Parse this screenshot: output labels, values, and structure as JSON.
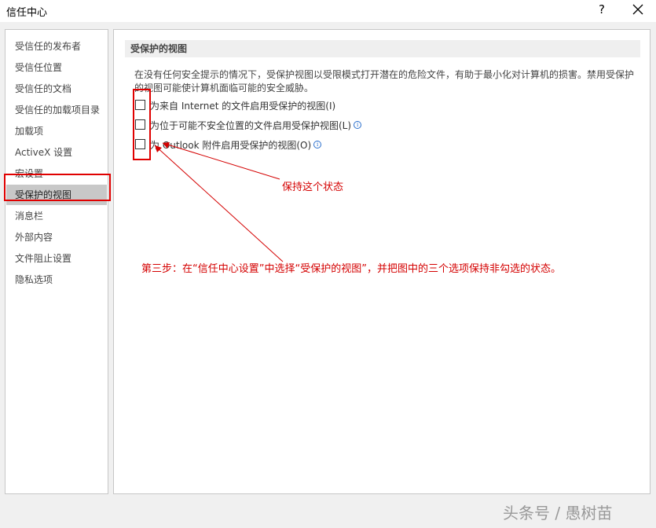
{
  "window": {
    "title": "信任中心",
    "help_label": "?",
    "close_icon": "close-icon"
  },
  "sidebar": {
    "items": [
      {
        "label": "受信任的发布者"
      },
      {
        "label": "受信任位置"
      },
      {
        "label": "受信任的文档"
      },
      {
        "label": "受信任的加载项目录"
      },
      {
        "label": "加载项"
      },
      {
        "label": "ActiveX 设置"
      },
      {
        "label": "宏设置"
      },
      {
        "label": "受保护的视图",
        "selected": true
      },
      {
        "label": "消息栏"
      },
      {
        "label": "外部内容"
      },
      {
        "label": "文件阻止设置"
      },
      {
        "label": "隐私选项"
      }
    ]
  },
  "main": {
    "section_title": "受保护的视图",
    "description": "在没有任何安全提示的情况下，受保护视图以受限模式打开潜在的危险文件，有助于最小化对计算机的损害。禁用受保护的视图可能使计算机面临可能的安全威胁。",
    "options": [
      {
        "label": "为来自 Internet 的文件启用受保护的视图(I)",
        "checked": false,
        "info_icon": false
      },
      {
        "label": "为位于可能不安全位置的文件启用受保护视图(L)",
        "checked": false,
        "info_icon": true
      },
      {
        "label": "为 Outlook 附件启用受保护的视图(O)",
        "checked": false,
        "info_icon": true
      }
    ]
  },
  "annotations": {
    "keep_state": "保持这个状态",
    "step_three": "第三步：在“信任中心设置”中选择“受保护的视图”，并把图中的三个选项保持非勾选的状态。",
    "color": "#d40000"
  },
  "watermark": "头条号 / 愚树苗"
}
